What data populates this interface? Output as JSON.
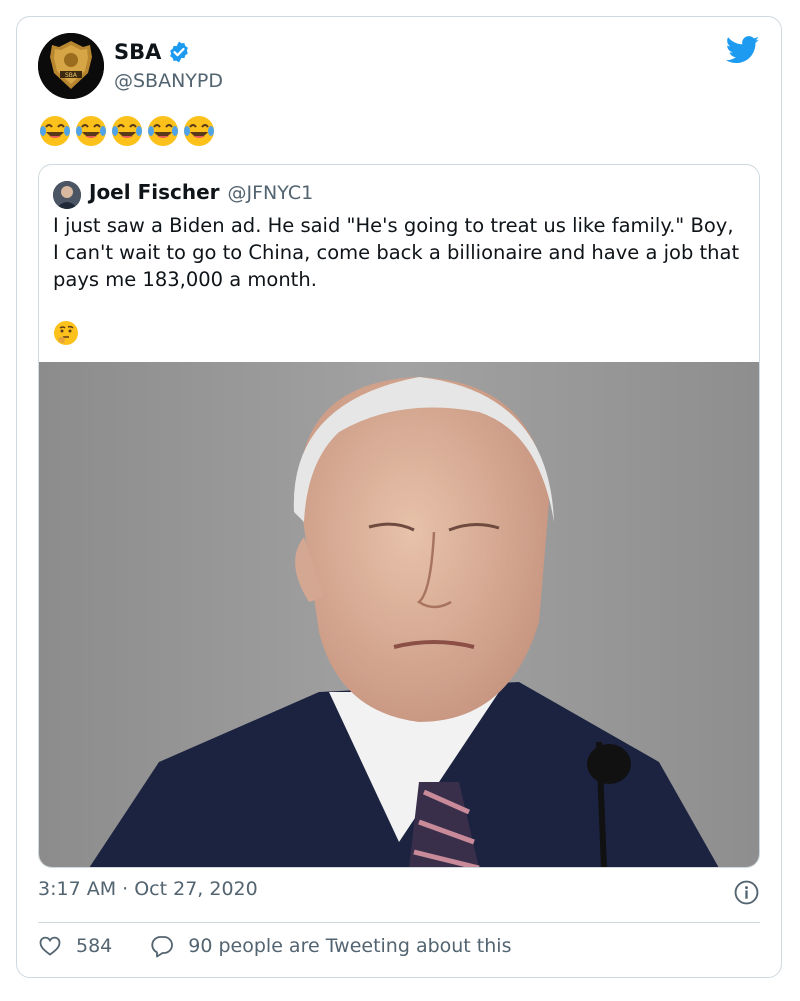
{
  "author": {
    "name": "SBA",
    "handle": "@SBANYPD",
    "avatar_text": "SBA"
  },
  "tweet_emojis": [
    "😂",
    "😂",
    "😂",
    "😂",
    "😂"
  ],
  "quoted_tweet": {
    "name": "Joel Fischer",
    "handle": "@JFNYC1",
    "text": "I just saw a Biden ad. He said \"He's going to treat us like family.\" Boy, I can't wait to go to China, come back a billionaire and have a job that pays me 183,000 a month.",
    "emoji": "🤔"
  },
  "timestamp": "3:17 AM · Oct 27, 2020",
  "stats": {
    "likes": "584",
    "tweeting": "90 people are Tweeting about this"
  },
  "colors": {
    "verified": "#1d9bf0",
    "twitter_blue": "#1d9bf0",
    "secondary_text": "#536471",
    "border": "#cfd9de"
  }
}
